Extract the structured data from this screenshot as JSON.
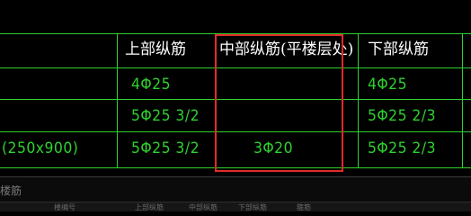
{
  "table": {
    "headers": {
      "upper": "上部纵筋",
      "middle": "中部纵筋(平楼层处)",
      "lower": "下部纵筋"
    },
    "rows": [
      {
        "upper": "4Φ25",
        "middle": "",
        "lower": "4Φ25"
      },
      {
        "upper": "5Φ25 3/2",
        "middle": "",
        "lower": "5Φ25 2/3"
      },
      {
        "section": "(250x900)",
        "upper": "5Φ25 3/2",
        "middle": "3Φ20",
        "lower": "5Φ25 2/3"
      }
    ]
  },
  "bottom_panel": {
    "label": "楼筋",
    "columns": [
      "楼编号",
      "上部纵筋",
      "中部纵筋",
      "下部纵筋",
      "箍筋"
    ]
  },
  "colors": {
    "background": "#000000",
    "grid_line": "#2fd12f",
    "header_text": "#ffffff",
    "value_text": "#2fd12f",
    "highlight_box": "#e02a2a"
  }
}
